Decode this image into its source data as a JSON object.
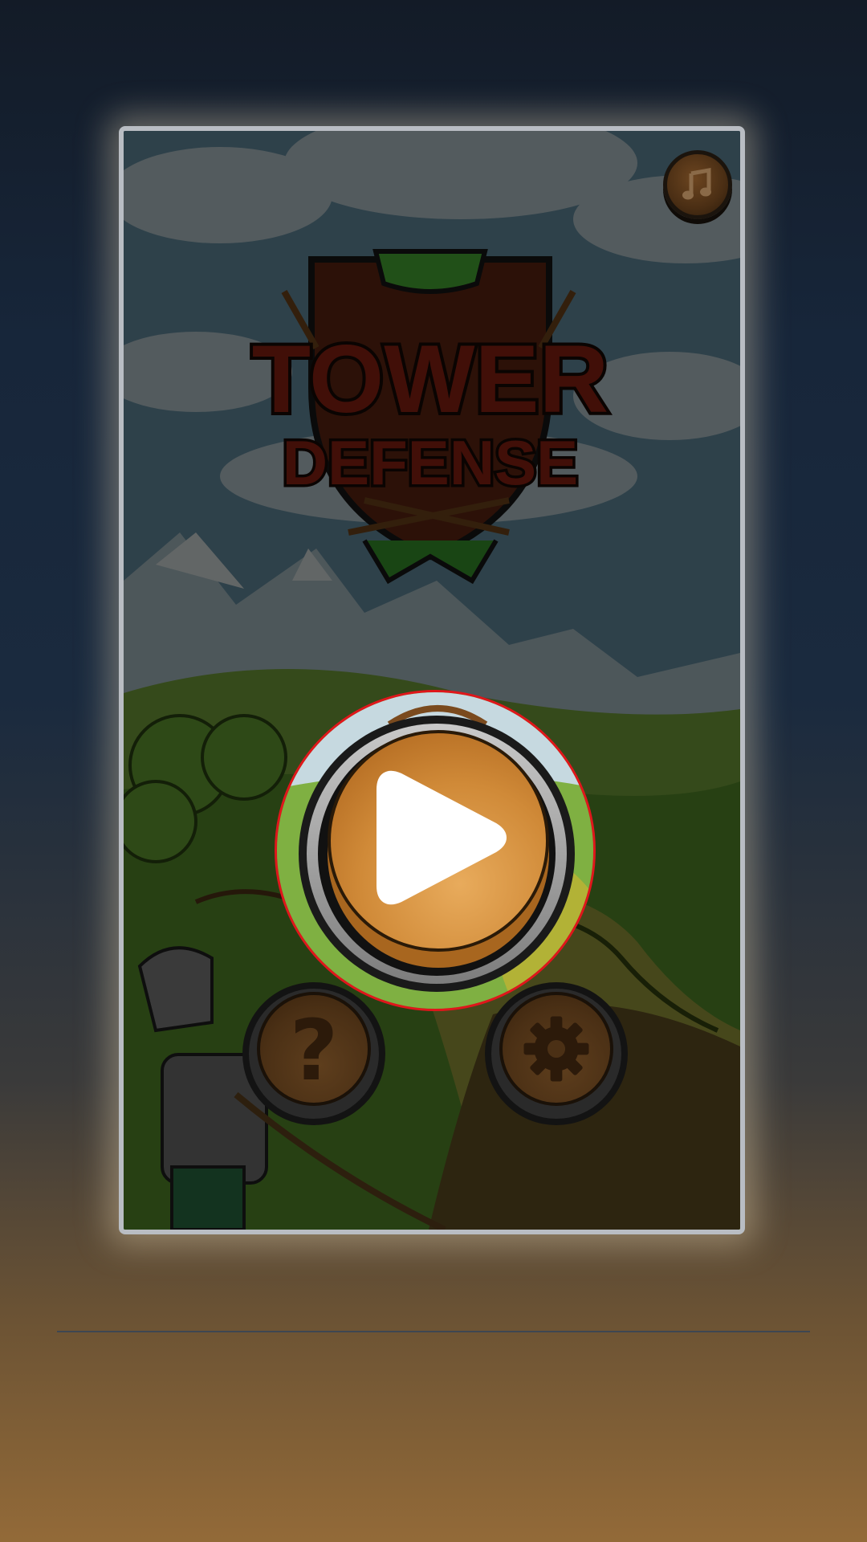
{
  "game": {
    "title_line1": "TOWER",
    "title_line2": "DEFENSE"
  },
  "buttons": {
    "music": "music-note-icon",
    "play": "play-icon",
    "help_label": "?",
    "settings": "gear-icon"
  },
  "colors": {
    "play_button": "#d08a38",
    "title_text": "#7a1a10",
    "focus_ring": "#e0161b",
    "frame_border": "#b9bdc3"
  }
}
